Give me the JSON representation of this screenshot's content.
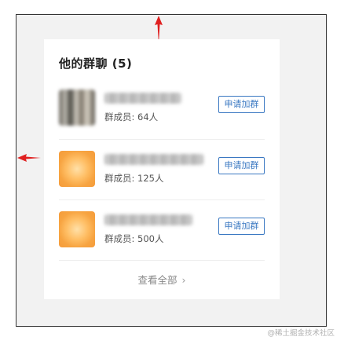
{
  "card": {
    "title": "他的群聊 (5)",
    "groups": [
      {
        "members": "群成员: 64人",
        "apply_label": "申请加群",
        "avatar": "photo-thumbnail"
      },
      {
        "members": "群成员: 125人",
        "apply_label": "申请加群",
        "avatar": "orange-thumbnail"
      },
      {
        "members": "群成员: 500人",
        "apply_label": "申请加群",
        "avatar": "orange-thumbnail"
      }
    ],
    "view_all": "查看全部",
    "view_all_icon": "chevron-right-icon"
  },
  "annotations": {
    "arrow_color": "#e02020",
    "arrow_up": "arrow-up-icon",
    "arrow_left": "arrow-left-icon"
  },
  "watermark": "@稀土掘金技术社区",
  "colors": {
    "accent": "#3a78c2",
    "background": "#f2f2f2",
    "orange_avatar": "#f59b3a"
  }
}
